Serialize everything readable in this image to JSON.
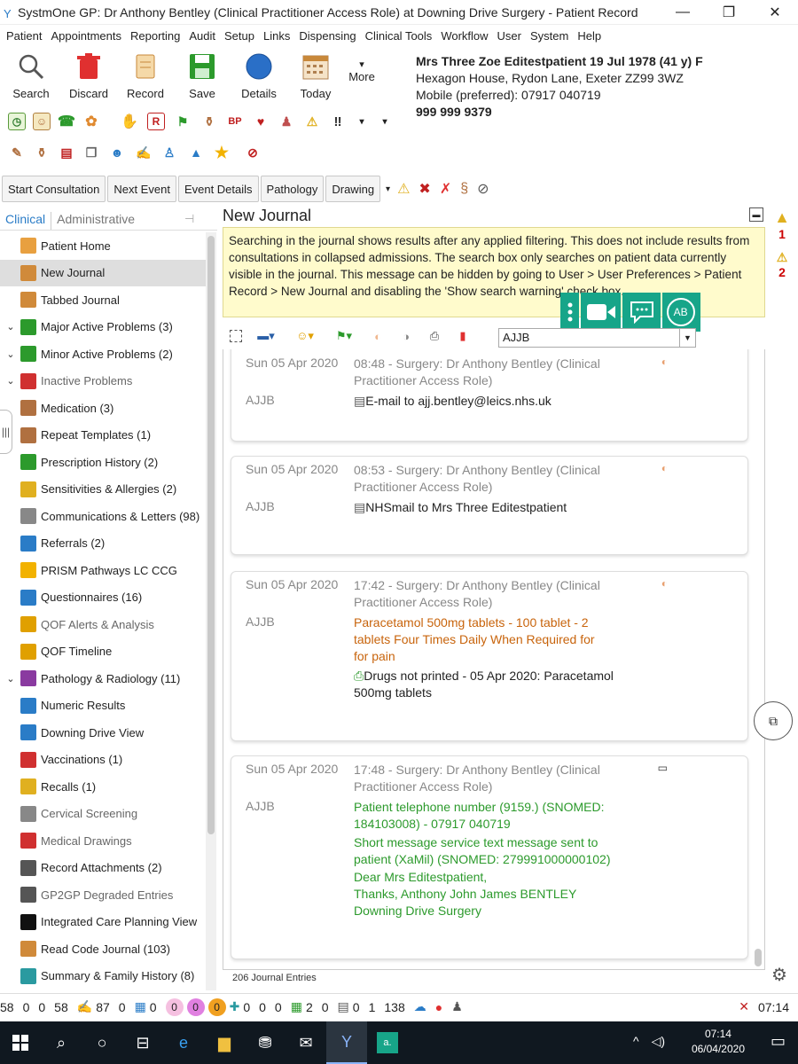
{
  "window": {
    "title": "SystmOne GP: Dr Anthony Bentley (Clinical Practitioner Access Role) at Downing Drive Surgery - Patient Record",
    "controls": [
      "—",
      "❐",
      "✕"
    ]
  },
  "menu": [
    "Patient",
    "Appointments",
    "Reporting",
    "Audit",
    "Setup",
    "Links",
    "Dispensing",
    "Clinical Tools",
    "Workflow",
    "User",
    "System",
    "Help"
  ],
  "toolbar": {
    "search": "Search",
    "discard": "Discard",
    "record": "Record",
    "save": "Save",
    "details": "Details",
    "today": "Today",
    "more": "More"
  },
  "patient": {
    "name": "Mrs Three Zoe Editestpatient 19 Jul 1978 (41 y) F",
    "address": "Hexagon House, Rydon Lane, Exeter ZZ99 3WZ",
    "mobile": "Mobile (preferred): 07917 040719",
    "nhs": "999 999 9379"
  },
  "nav_buttons": [
    "Start Consultation",
    "Next Event",
    "Event Details",
    "Pathology",
    "Drawing"
  ],
  "left_tabs": {
    "clinical": "Clinical",
    "administrative": "Administrative"
  },
  "sidebar": [
    {
      "label": "Patient Home",
      "icon": "person-icon",
      "color": "#e8a040"
    },
    {
      "label": "New Journal",
      "icon": "journal-icon",
      "color": "#d08a3a",
      "selected": true
    },
    {
      "label": "Tabbed Journal",
      "icon": "journal-icon",
      "color": "#d08a3a"
    },
    {
      "label": "Major Active Problems (3)",
      "icon": "flag-icon",
      "color": "#2c9a2c",
      "chev": true
    },
    {
      "label": "Minor Active Problems (2)",
      "icon": "flag-icon",
      "color": "#2c9a2c",
      "chev": true
    },
    {
      "label": "Inactive Problems",
      "icon": "flag-icon",
      "color": "#d03030",
      "chev": true,
      "grey": true
    },
    {
      "label": "Medication (3)",
      "icon": "bottle-icon",
      "color": "#b07040"
    },
    {
      "label": "Repeat Templates (1)",
      "icon": "bottles-icon",
      "color": "#b07040"
    },
    {
      "label": "Prescription History (2)",
      "icon": "prescription-icon",
      "color": "#2c9a2c"
    },
    {
      "label": "Sensitivities & Allergies (2)",
      "icon": "allergy-icon",
      "color": "#e0b020"
    },
    {
      "label": "Communications & Letters (98)",
      "icon": "letter-icon",
      "color": "#888888"
    },
    {
      "label": "Referrals (2)",
      "icon": "arrow-icon",
      "color": "#2a7cc7"
    },
    {
      "label": "PRISM Pathways LC CCG",
      "icon": "star-icon",
      "color": "#f2b200"
    },
    {
      "label": "Questionnaires (16)",
      "icon": "question-icon",
      "color": "#2a7cc7"
    },
    {
      "label": "QOF Alerts & Analysis",
      "icon": "qof-icon",
      "color": "#e0a000",
      "grey": true
    },
    {
      "label": "QOF Timeline",
      "icon": "qof-timeline-icon",
      "color": "#e0a000"
    },
    {
      "label": "Pathology & Radiology (11)",
      "icon": "test-tubes-icon",
      "color": "#8a3aa0",
      "chev": true
    },
    {
      "label": "Numeric Results",
      "icon": "chart-icon",
      "color": "#2a7cc7"
    },
    {
      "label": "Downing Drive View",
      "icon": "eye-icon",
      "color": "#2a7cc7"
    },
    {
      "label": "Vaccinations (1)",
      "icon": "syringe-icon",
      "color": "#d03030"
    },
    {
      "label": "Recalls (1)",
      "icon": "recall-icon",
      "color": "#e0b020"
    },
    {
      "label": "Cervical Screening",
      "icon": "cervical-icon",
      "color": "#888888",
      "grey": true
    },
    {
      "label": "Medical Drawings",
      "icon": "drawing-icon",
      "color": "#d03030",
      "grey": true
    },
    {
      "label": "Record Attachments (2)",
      "icon": "paperclip-icon",
      "color": "#555555"
    },
    {
      "label": "GP2GP Degraded Entries",
      "icon": "gp2gp-icon",
      "color": "#555555",
      "grey": true
    },
    {
      "label": "Integrated Care Planning View",
      "icon": "dot-icon",
      "color": "#111111"
    },
    {
      "label": "Read Code Journal (103)",
      "icon": "journal-icon",
      "color": "#d08a3a"
    },
    {
      "label": "Summary & Family History (8)",
      "icon": "summary-icon",
      "color": "#2a9aa0"
    }
  ],
  "journal": {
    "title": "New Journal",
    "warning": "Searching in the journal shows results after any applied filtering. This does not include results from consultations in collapsed admissions. The search box only searches on patient data currently visible in the journal. This message can be hidden by going to User > User Preferences > Patient Record > New Journal and disabling the 'Show search warning' check box.",
    "filter_value": "AJJB",
    "count": "206 Journal Entries",
    "side_warnings": [
      "1",
      "2"
    ],
    "entries": [
      {
        "date": "Sun 05 Apr 2020",
        "source": "08:48 - Surgery: Dr Anthony Bentley (Clinical Practitioner Access Role)",
        "user": "AJJB",
        "lines": [
          {
            "text": "E-mail to ajj.bentley@leics.nhs.uk",
            "style": "plain",
            "icon": "document-icon"
          }
        ]
      },
      {
        "date": "Sun 05 Apr 2020",
        "source": "08:53 - Surgery: Dr Anthony Bentley (Clinical Practitioner Access Role)",
        "user": "AJJB",
        "lines": [
          {
            "text": "NHSmail to Mrs Three Editestpatient",
            "style": "plain",
            "icon": "document-icon"
          }
        ]
      },
      {
        "date": "Sun 05 Apr 2020",
        "source": "17:42 - Surgery: Dr Anthony Bentley (Clinical Practitioner Access Role)",
        "user": "AJJB",
        "lines": [
          {
            "text": "Paracetamol 500mg tablets - 100 tablet - 2 tablets Four Times Daily When Required for for pain",
            "style": "orange"
          },
          {
            "text": "Drugs not printed - 05 Apr 2020: Paracetamol 500mg tablets",
            "style": "plain",
            "icon": "print-icon"
          }
        ]
      },
      {
        "date": "Sun 05 Apr 2020",
        "source": "17:48 - Surgery: Dr Anthony Bentley (Clinical Practitioner Access Role)",
        "user": "AJJB",
        "lines": [
          {
            "text": "Patient telephone number (9159.) (SNOMED: 184103008) - 07917 040719",
            "style": "green"
          },
          {
            "text": "Short message service text message sent to patient (XaMil) (SNOMED: 279991000000102)",
            "style": "green"
          },
          {
            "text": "Dear Mrs Editestpatient,",
            "style": "green"
          },
          {
            "text": "Thanks, Anthony John James BENTLEY",
            "style": "green"
          },
          {
            "text": "Downing Drive Surgery",
            "style": "green"
          }
        ]
      }
    ]
  },
  "video_controls": {
    "avatar": "AB"
  },
  "statusbar": {
    "values": [
      "58",
      "0",
      "0",
      "58",
      "87",
      "0",
      "0",
      "0",
      "0",
      "0",
      "0",
      "0",
      "0",
      "2",
      "0",
      "0",
      "1",
      "138"
    ],
    "time": "07:14"
  },
  "taskbar": {
    "time": "07:14",
    "date": "06/04/2020",
    "app_label": "a."
  },
  "colors": {
    "accent": "#2a7cc7",
    "warning_bg": "#fffbcc",
    "video_green": "#17a589",
    "orange_text": "#c8640c",
    "green_text": "#2c9a2c"
  }
}
